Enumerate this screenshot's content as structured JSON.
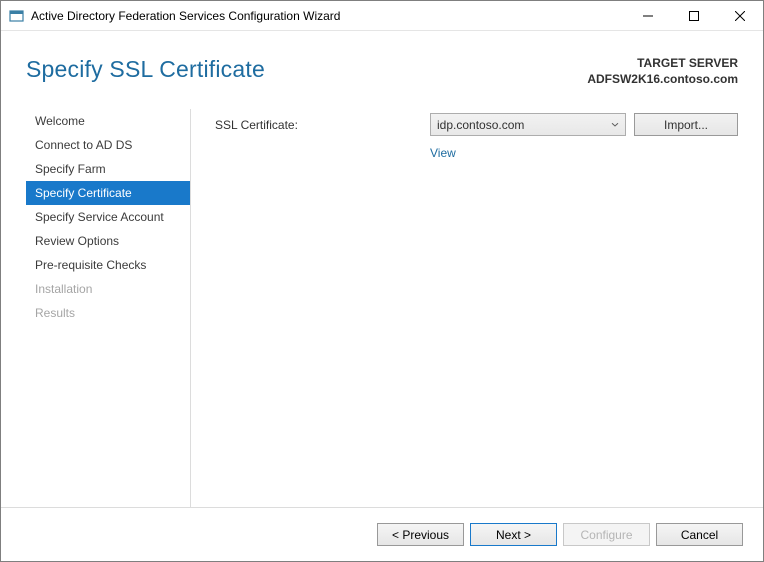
{
  "window": {
    "title": "Active Directory Federation Services Configuration Wizard"
  },
  "header": {
    "page_title": "Specify SSL Certificate",
    "target_label": "TARGET SERVER",
    "target_value": "ADFSW2K16.contoso.com"
  },
  "sidebar": {
    "items": [
      {
        "label": "Welcome"
      },
      {
        "label": "Connect to AD DS"
      },
      {
        "label": "Specify Farm"
      },
      {
        "label": "Specify Certificate"
      },
      {
        "label": "Specify Service Account"
      },
      {
        "label": "Review Options"
      },
      {
        "label": "Pre-requisite Checks"
      },
      {
        "label": "Installation"
      },
      {
        "label": "Results"
      }
    ]
  },
  "main": {
    "ssl_label": "SSL Certificate:",
    "ssl_selected": "idp.contoso.com",
    "import_label": "Import...",
    "view_label": "View"
  },
  "footer": {
    "previous": "< Previous",
    "next": "Next >",
    "configure": "Configure",
    "cancel": "Cancel"
  }
}
